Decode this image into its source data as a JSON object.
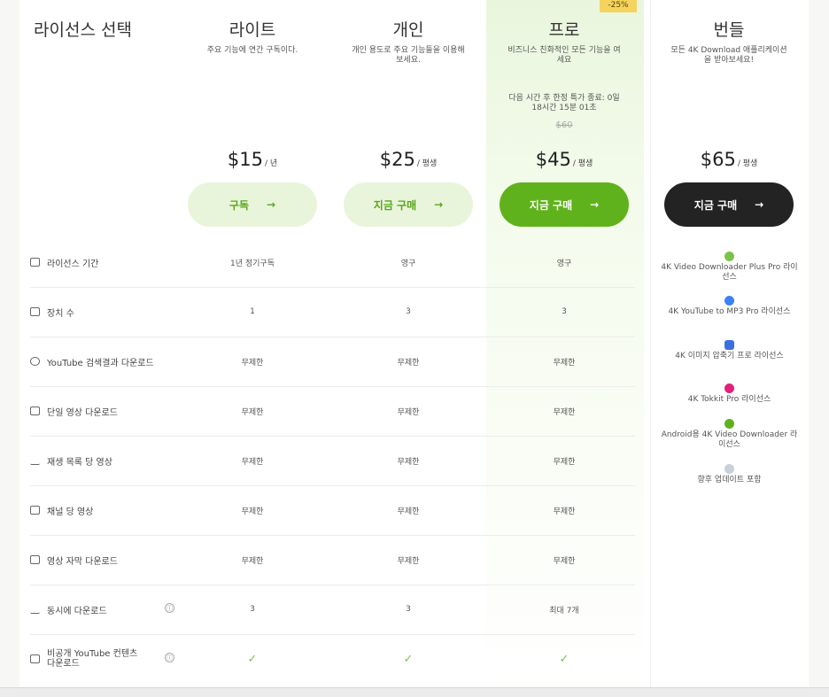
{
  "header": {
    "title": "라이선스 선택",
    "discount_badge": "-25%"
  },
  "plans": [
    {
      "name": "라이트",
      "desc": "주요 기능에 연간 구독이다.",
      "price": "$15",
      "period": "/ 년",
      "button": "구독",
      "arrow": "→"
    },
    {
      "name": "개인",
      "desc": "개인 용도로 주요 기능들을 이용해 보세요.",
      "price": "$25",
      "period": "/ 평생",
      "button": "지금 구매",
      "arrow": "→"
    },
    {
      "name": "프로",
      "desc": "비즈니스 친화적인 모든 기능을 여세요",
      "promo": "다음 시간 후 한정 특가 종료: 0일 18시간 15분 01초",
      "old_price": "$60",
      "price": "$45",
      "period": "/ 평생",
      "button": "지금 구매",
      "arrow": "→"
    },
    {
      "name": "번들",
      "desc": "모든 4K Download 애플리케이션을 받아보세요!",
      "price": "$65",
      "period": "/ 평생",
      "button": "지금 구매",
      "arrow": "→"
    }
  ],
  "features": [
    {
      "label": "라이선스 기간",
      "icon": "calendar-icon",
      "values": [
        "1년 정기구독",
        "영구",
        "영구"
      ]
    },
    {
      "label": "장치 수",
      "icon": "devices-icon",
      "values": [
        "1",
        "3",
        "3"
      ]
    },
    {
      "label": "YouTube 검색결과 다운로드",
      "icon": "search-result-icon",
      "values": [
        "무제한",
        "무제한",
        "무제한"
      ]
    },
    {
      "label": "단일 영상 다운로드",
      "icon": "video-icon",
      "values": [
        "무제한",
        "무제한",
        "무제한"
      ]
    },
    {
      "label": "재생 목록 당 영상",
      "icon": "playlist-icon",
      "values": [
        "무제한",
        "무제한",
        "무제한"
      ]
    },
    {
      "label": "채널 당 영상",
      "icon": "channel-icon",
      "values": [
        "무제한",
        "무제한",
        "무제한"
      ]
    },
    {
      "label": "영상 자막 다운로드",
      "icon": "subtitles-icon",
      "values": [
        "무제한",
        "무제한",
        "무제한"
      ]
    },
    {
      "label": "동시에 다운로드",
      "icon": "download-icon",
      "info": "ⓘ",
      "values": [
        "3",
        "3",
        "최대 7개"
      ]
    },
    {
      "label": "비공개 YouTube 컨텐츠 다운로드",
      "icon": "lock-icon",
      "info": "ⓘ",
      "values": [
        "✓",
        "✓",
        "✓"
      ]
    }
  ],
  "bundle_items": [
    {
      "label": "4K Video Downloader Plus Pro 라이선스",
      "color": "#7cc24a"
    },
    {
      "label": "4K YouTube to MP3 Pro 라이선스",
      "color": "#3b82f6"
    },
    {
      "label": "4K 이미지 압축기 프로 라이선스",
      "color": "#3b6fe0"
    },
    {
      "label": "4K Tokkit Pro 라이선스",
      "color": "#e0207a"
    },
    {
      "label": "Android용 4K Video Downloader 라이선스",
      "color": "#5fb21b"
    },
    {
      "label": "향후 업데이트 포함",
      "color": "#c8d0da"
    }
  ]
}
